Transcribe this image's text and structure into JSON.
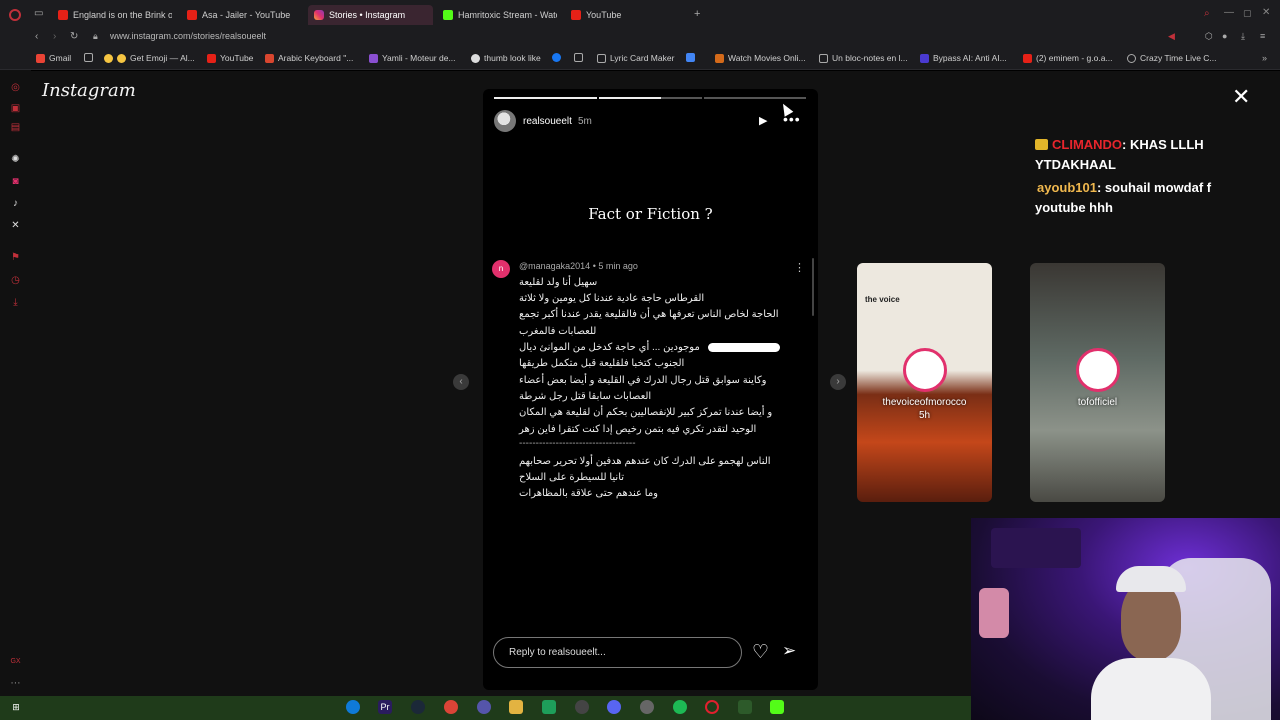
{
  "browser": {
    "tabs": [
      {
        "label": "England is on the Brink of",
        "icon": "youtube-icon"
      },
      {
        "label": "Asa - Jailer - YouTube",
        "icon": "youtube-icon"
      },
      {
        "label": "Stories • Instagram",
        "icon": "instagram-icon",
        "active": true
      },
      {
        "label": "Hamritoxic Stream - Watc",
        "icon": "kick-icon"
      },
      {
        "label": "YouTube",
        "icon": "youtube-icon"
      }
    ],
    "url": "www.instagram.com/stories/realsoueelt",
    "bookmarks": [
      {
        "label": "Gmail"
      },
      {
        "label": ""
      },
      {
        "label": "Get Emoji — Al..."
      },
      {
        "label": "YouTube"
      },
      {
        "label": "Arabic Keyboard \"..."
      },
      {
        "label": "Yamli - Moteur de..."
      },
      {
        "label": "thumb look like"
      },
      {
        "label": ""
      },
      {
        "label": ""
      },
      {
        "label": "Lyric Card Maker"
      },
      {
        "label": ""
      },
      {
        "label": "Watch Movies Onli..."
      },
      {
        "label": "Un bloc-notes en l..."
      },
      {
        "label": "Bypass AI: Anti AI..."
      },
      {
        "label": "(2) eminem - g.o.a..."
      },
      {
        "label": "Crazy Time Live C..."
      }
    ]
  },
  "instagram": {
    "logo": "Instagram",
    "close_icon": "close-icon",
    "story": {
      "username": "realsoueelt",
      "time": "5m",
      "progress": [
        1,
        0.6,
        0
      ],
      "headline": "Fact or Fiction ?",
      "comment": {
        "avatar_letter": "n",
        "author": "@managaka2014 • 5 min ago",
        "lines": [
          "سهيل أنا ولد لقليعة",
          "القرطاس حاجة عادية عندنا كل يومين ولا ثلاثة",
          "الحاجة لخاص الناس تعرفها هي أن فالقليعة يقدر عندنا أكبر تجمع",
          "للعصابات فالمغرب",
          "موجودين ... أي حاجة كدخل من الموانئ ديال",
          "الجنوب كتخبا فلقليعة قبل متكمل طريقها",
          "وكاينة سوابق قتل رجال الدرك في القليعة و أيضا بعض أعضاء",
          "العصابات سابقا قتل رجل شرطة",
          "و أيضا عندنا تمركز كبير للإنفصاليين بحكم أن لقليعة هي المكان",
          "الوحيد لتقدر تكري فيه بتمن رخيص إدا كنت كتقرا فاين زهر",
          "-----------------------------------",
          "الناس لهجمو على الدرك كان عندهم هدفين أولا تحرير صحابهم",
          "تانيا للسيطرة على السلاح",
          "وما عندهم حتى علاقة بالمظاهرات"
        ]
      },
      "reply_placeholder": "Reply to realsoueelt..."
    },
    "next_stories": [
      {
        "name": "thevoiceofmorocco",
        "time": "5h",
        "brand": "the voice"
      },
      {
        "name": "tofofficiel",
        "time": ""
      }
    ]
  },
  "stream_chat": [
    {
      "user": "CLIMANDO",
      "message": ": KHAS LLLH",
      "cont": "YTDAKHAAL"
    },
    {
      "user": "ayoub101",
      "message": ": souhail mowdaf f",
      "cont": "youtube hhh"
    }
  ],
  "colors": {
    "accent_instagram": "#e1306c",
    "chat_user1": "#e8252c",
    "chat_user2": "#f0b84e",
    "taskbar": "#1f3b1a"
  }
}
